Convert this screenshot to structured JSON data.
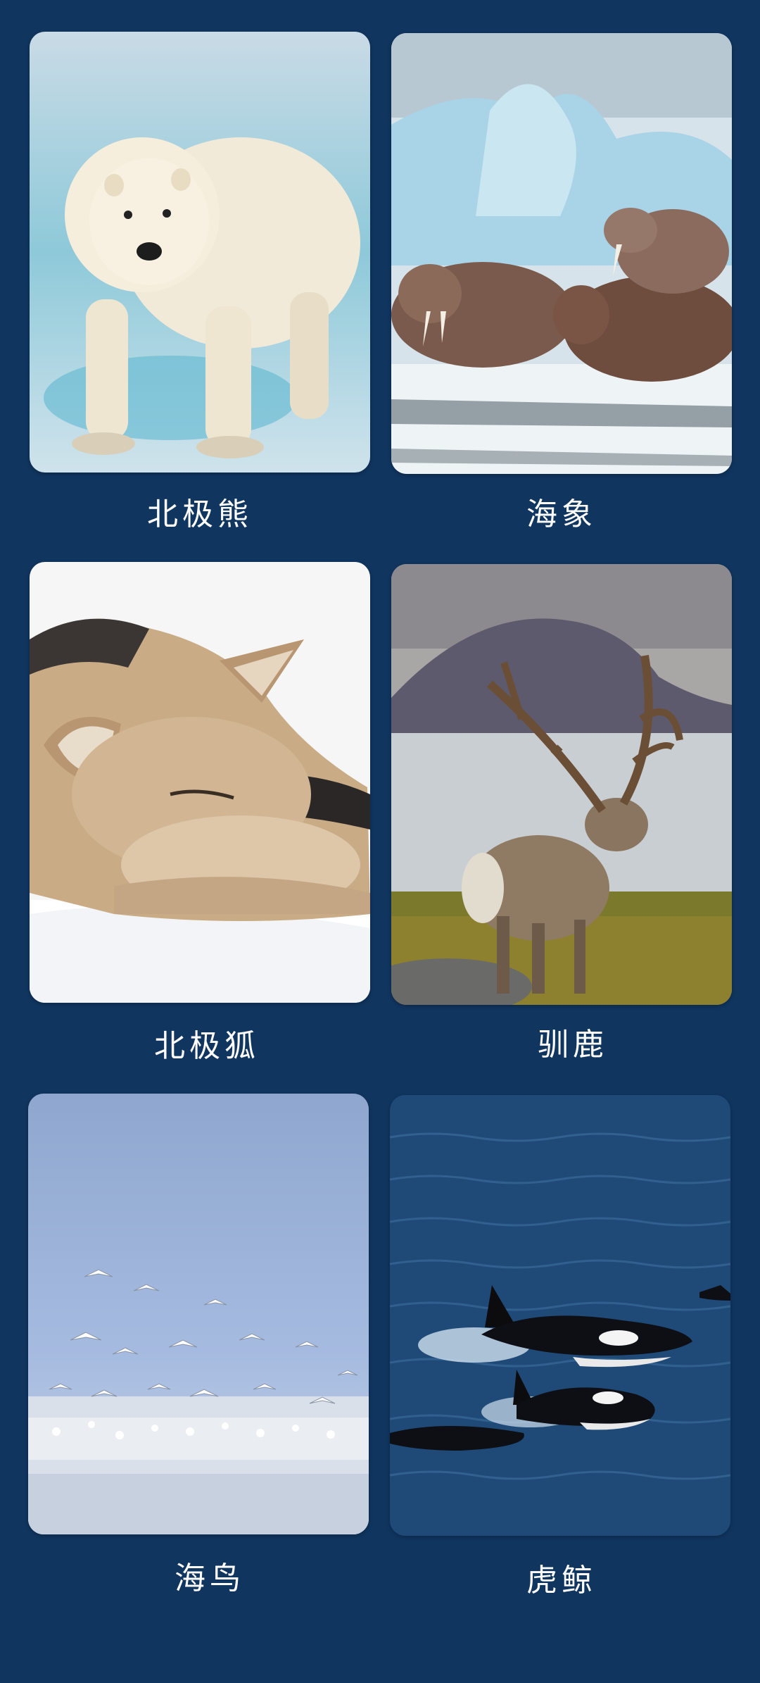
{
  "grid": {
    "items": [
      {
        "label": "北极熊",
        "image": "polar-bear-photo"
      },
      {
        "label": "海象",
        "image": "walrus-photo"
      },
      {
        "label": "北极狐",
        "image": "arctic-fox-photo"
      },
      {
        "label": "驯鹿",
        "image": "reindeer-photo"
      },
      {
        "label": "海鸟",
        "image": "seabirds-photo"
      },
      {
        "label": "虎鲸",
        "image": "orca-photo"
      }
    ]
  },
  "colors": {
    "background": "#10355f",
    "label_text": "#ffffff"
  }
}
